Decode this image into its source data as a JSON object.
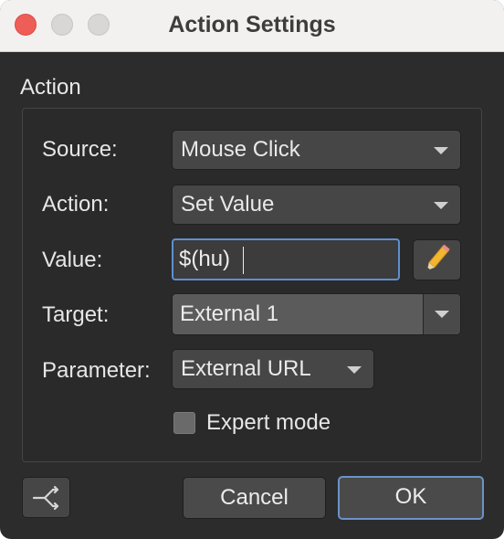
{
  "window": {
    "title": "Action Settings"
  },
  "group": {
    "title": "Action"
  },
  "fields": {
    "source": {
      "label": "Source:",
      "value": "Mouse Click"
    },
    "action": {
      "label": "Action:",
      "value": "Set Value"
    },
    "value": {
      "label": "Value:",
      "value": "$(hu)"
    },
    "target": {
      "label": "Target:",
      "value": "External 1"
    },
    "parameter": {
      "label": "Parameter:",
      "value": "External URL"
    }
  },
  "expert_mode": {
    "label": "Expert mode",
    "checked": false
  },
  "buttons": {
    "cancel": "Cancel",
    "ok": "OK"
  },
  "icons": {
    "edit": "pencil-icon",
    "routing": "branch-icon",
    "dropdown": "chevron-down-icon"
  },
  "colors": {
    "accent_focus": "#5e8fd0",
    "default_button_border": "#6b93c9",
    "pencil_body": "#f2b632"
  }
}
